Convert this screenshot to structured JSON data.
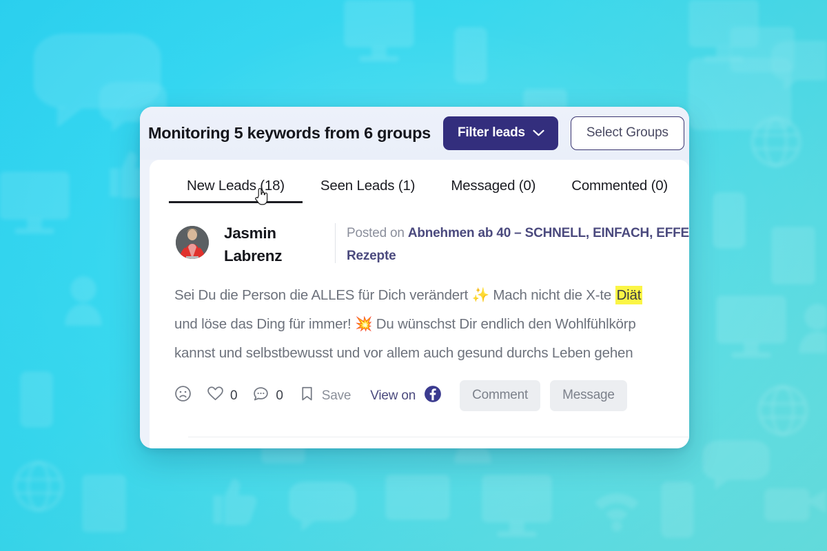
{
  "background": {
    "style": "cyan gradient with blurred social media icons",
    "color_from": "#2fd3f2",
    "color_to": "#6fe0dd"
  },
  "card": {
    "header": {
      "title": "Monitoring 5 keywords from 6 groups",
      "filter_button": {
        "label": "Filter leads",
        "icon": "chevron-down-icon",
        "bg": "#332e7d",
        "fg": "#ffffff"
      },
      "select_groups_button": {
        "label": "Select Groups",
        "border": "#3a3570"
      }
    },
    "tabs": [
      {
        "label": "New Leads (18)",
        "active": true
      },
      {
        "label": "Seen Leads (1)",
        "active": false
      },
      {
        "label": "Messaged (0)",
        "active": false
      },
      {
        "label": "Commented (0)",
        "active": false
      }
    ],
    "lead": {
      "author": "Jasmin Labrenz",
      "avatar": "person-in-red-jacket-avatar",
      "posted_label": "Posted on",
      "group_name": "Abnehmen ab 40 – SCHNELL, EINFACH, EFFE",
      "group_name_line2": "Rezepte",
      "body_lines": [
        "Sei Du die Person die ALLES für Dich verändert ✨ Mach nicht die X-te ",
        "und löse das Ding für immer! 💥 Du wünschst Dir endlich den Wohlfühlkörp",
        "kannst und selbstbewusst und vor allem auch gesund durchs Leben gehen"
      ],
      "highlighted_keyword": "Diät",
      "highlight_color": "#fbf545",
      "actions": {
        "react_icon": "frowning-face-icon",
        "like_icon": "heart-icon",
        "like_count": "0",
        "comment_icon": "comment-bubble-icon",
        "comment_count": "0",
        "save_icon": "bookmark-icon",
        "save_label": "Save",
        "view_on_label": "View on",
        "view_on_icon": "facebook-icon",
        "facebook_color": "#3b3b8f",
        "comment_button": "Comment",
        "message_button": "Message"
      }
    }
  },
  "cursor": {
    "type": "pointing-hand-cursor"
  }
}
